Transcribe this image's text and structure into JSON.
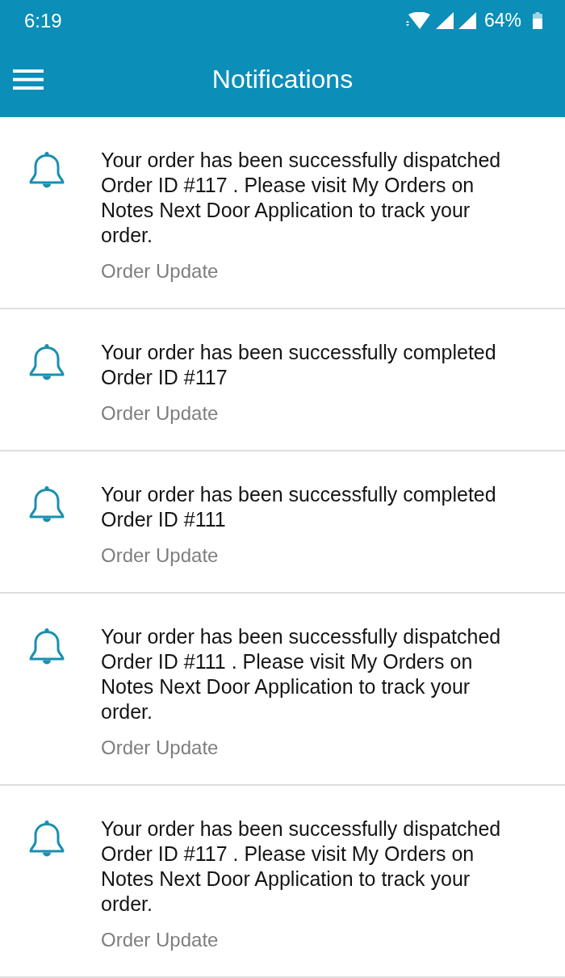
{
  "status_bar": {
    "time": "6:19",
    "battery": "64%"
  },
  "app_bar": {
    "title": "Notifications"
  },
  "notifications": [
    {
      "message": "Your order has been successfully dispatched Order ID #117 . Please visit My Orders on Notes Next Door Application to track your order.",
      "category": "Order Update"
    },
    {
      "message": "Your order has been successfully completed Order ID #117",
      "category": "Order Update"
    },
    {
      "message": "Your order has been successfully completed Order ID #111",
      "category": "Order Update"
    },
    {
      "message": "Your order has been successfully dispatched Order ID #111 . Please visit My Orders on Notes Next Door Application to track your order.",
      "category": "Order Update"
    },
    {
      "message": "Your order has been successfully dispatched Order ID #117 . Please visit My Orders on Notes Next Door Application to track your order.",
      "category": "Order Update"
    }
  ]
}
